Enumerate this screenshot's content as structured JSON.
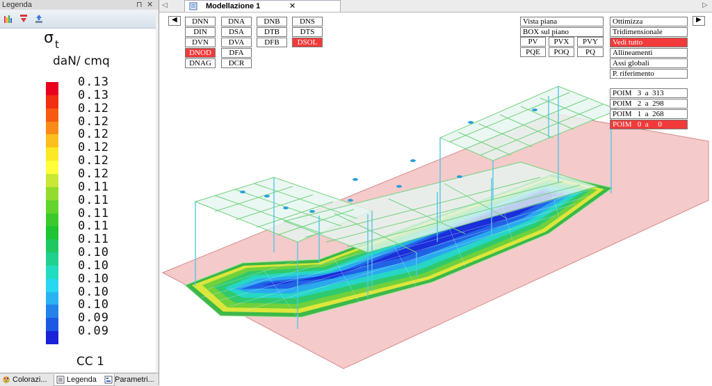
{
  "legend_panel": {
    "title": "Legenda",
    "pin_glyph": "⊓",
    "close_glyph": "✕",
    "toolbar_icons": [
      "bars-chart-icon",
      "red-filter-icon",
      "export-icon"
    ],
    "symbol": "σ",
    "subscript": "t",
    "unit": "daN/ cmq",
    "scale": [
      {
        "color": "#e8001c",
        "value": "0.13"
      },
      {
        "color": "#f22f10",
        "value": "0.13"
      },
      {
        "color": "#f75a10",
        "value": "0.12"
      },
      {
        "color": "#f98b18",
        "value": "0.12"
      },
      {
        "color": "#fcbf1e",
        "value": "0.12"
      },
      {
        "color": "#fbe925",
        "value": "0.12"
      },
      {
        "color": "#ffff3a",
        "value": "0.12"
      },
      {
        "color": "#c8e835",
        "value": "0.12"
      },
      {
        "color": "#93dc2e",
        "value": "0.11"
      },
      {
        "color": "#62d42c",
        "value": "0.11"
      },
      {
        "color": "#3cc92d",
        "value": "0.11"
      },
      {
        "color": "#1ec431",
        "value": "0.11"
      },
      {
        "color": "#1ec861",
        "value": "0.11"
      },
      {
        "color": "#21d08f",
        "value": "0.10"
      },
      {
        "color": "#23dcc0",
        "value": "0.10"
      },
      {
        "color": "#27d8f0",
        "value": "0.10"
      },
      {
        "color": "#2ab3f2",
        "value": "0.10"
      },
      {
        "color": "#2383ea",
        "value": "0.10"
      },
      {
        "color": "#1b58e3",
        "value": "0.09"
      },
      {
        "color": "#1a22d8",
        "value": "0.09"
      }
    ],
    "load_case": "CC  1"
  },
  "bottom_tabs": [
    {
      "label": "Colorazi...",
      "icon": "palette-icon",
      "active": false
    },
    {
      "label": "Legenda",
      "icon": "legend-list-icon",
      "active": true
    },
    {
      "label": "Parametri...",
      "icon": "parameters-icon",
      "active": false
    }
  ],
  "document_tab": {
    "title": "Modellazione 1",
    "close_glyph": "✕"
  },
  "nav_arrows": {
    "left": "◀",
    "right": "▶"
  },
  "view_buttons_left": [
    [
      "DNN",
      "DNA",
      "DNB",
      "DNS"
    ],
    [
      "DIN",
      "DSA",
      "DTB",
      "DTS"
    ],
    [
      "DVN",
      "DVA",
      "DFB",
      "DSOL"
    ],
    [
      "DNOD",
      "DFA"
    ],
    [
      "DNAG",
      "DCR"
    ]
  ],
  "active_left": [
    "DNOD",
    "DSOL"
  ],
  "view_buttons_mid": {
    "vista_piana": "Vista piana",
    "box_sul_piano": "BOX  sul  piano",
    "row1": [
      "PV",
      "PVX",
      "PVY"
    ],
    "row2": [
      "PQE",
      "POQ",
      "PQ"
    ]
  },
  "view_buttons_right": [
    "Ottimizza",
    "Tridimensionale",
    "Vedi  tutto",
    "Allineamenti",
    "Assi  globali",
    "P.  riferimento"
  ],
  "active_right": "Vedi  tutto",
  "poim_buttons": [
    "POIM   3  a  313",
    "POIM   2  a  298",
    "POIM   1  a  268",
    "POIM   0  a     0"
  ],
  "active_poim": "POIM   0  a     0",
  "colors": {
    "active_button": "#f23a3a",
    "slab": "#f4caca",
    "frame_beams": "#6fd17b",
    "columns": "#54c6e4",
    "panel": "#f0f0f0"
  }
}
